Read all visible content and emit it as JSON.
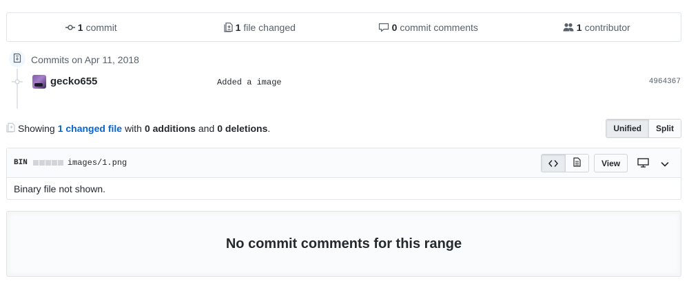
{
  "summary": {
    "commits_count": "1",
    "commits_label": "commit",
    "files_count": "1",
    "files_label": "file changed",
    "comments_count": "0",
    "comments_label": "commit comments",
    "contributors_count": "1",
    "contributors_label": "contributor"
  },
  "commits": {
    "date_heading": "Commits on Apr 11, 2018",
    "items": [
      {
        "author": "gecko655",
        "message": "Added a image",
        "sha": "4964367"
      }
    ]
  },
  "toc": {
    "showing": "Showing",
    "changed_link": "1 changed file",
    "with": "with",
    "additions": "0 additions",
    "and": "and",
    "deletions": "0 deletions",
    "period": "."
  },
  "diff_view": {
    "unified": "Unified",
    "split": "Split",
    "selected": "Unified"
  },
  "file": {
    "type_label": "BIN",
    "path": "images/1.png",
    "view_label": "View",
    "body": "Binary file not shown."
  },
  "blankslate": {
    "title": "No commit comments for this range"
  },
  "icons": {
    "commit": "git-commit-icon",
    "file": "file-diff-icon",
    "comment": "comment-icon",
    "people": "people-icon",
    "code": "code-icon",
    "document": "file-icon",
    "desktop": "device-desktop-icon",
    "chevron": "chevron-down-icon"
  },
  "colors": {
    "link": "#0366d6",
    "muted": "#586069",
    "border": "#e1e4e8",
    "badge_bg": "#f1f8ff"
  }
}
